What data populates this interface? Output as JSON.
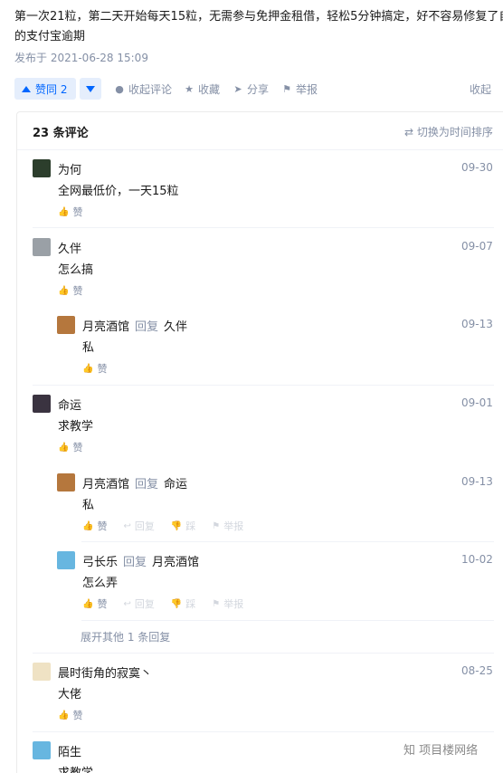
{
  "answer": {
    "line1": "第一次21粒，第二天开始每天15粒，无需参与免押金租借，轻松5分钟搞定，好不容易修复了自己",
    "line2": "的支付宝逾期",
    "published": "发布于 2021-06-28 15:09"
  },
  "actions": {
    "vote_label": "赞同 2",
    "collapse_comments": "收起评论",
    "favorite": "收藏",
    "share": "分享",
    "report": "举报",
    "fold": "收起"
  },
  "comments_panel": {
    "count_label": "23 条评论",
    "switch_sort": "切换为时间排序",
    "expand_replies": "展开其他 1 条回复"
  },
  "comments": [
    {
      "author": "为何",
      "date": "09-30",
      "content": "全网最低价，一天15粒",
      "like": "赞"
    },
    {
      "author": "久伴",
      "date": "09-07",
      "content": "怎么搞",
      "like": "赞"
    },
    {
      "author": "月亮酒馆",
      "reply_word": "回复",
      "reply_to": "久伴",
      "date": "09-13",
      "content": "私",
      "like": "赞"
    },
    {
      "author": "命运",
      "date": "09-01",
      "content": "求教学",
      "like": "赞"
    },
    {
      "author": "月亮酒馆",
      "reply_word": "回复",
      "reply_to": "命运",
      "date": "09-13",
      "content": "私",
      "like": "赞",
      "reply": "回复",
      "dislike": "踩",
      "report": "举报"
    },
    {
      "author": "弓长乐",
      "reply_word": "回复",
      "reply_to": "月亮酒馆",
      "date": "10-02",
      "content": "怎么弄",
      "like": "赞",
      "reply": "回复",
      "dislike": "踩",
      "report": "举报"
    },
    {
      "author": "晨时街角的寂寞丶",
      "date": "08-25",
      "content": "大佬",
      "like": "赞"
    },
    {
      "author": "陌生",
      "date": "",
      "content": "求教学",
      "like": ""
    }
  ],
  "watermark": "知 项目楼网络",
  "colors": {
    "accent": "#0066ff",
    "vote_bg": "#e5eefc",
    "meta": "#8590a6"
  }
}
